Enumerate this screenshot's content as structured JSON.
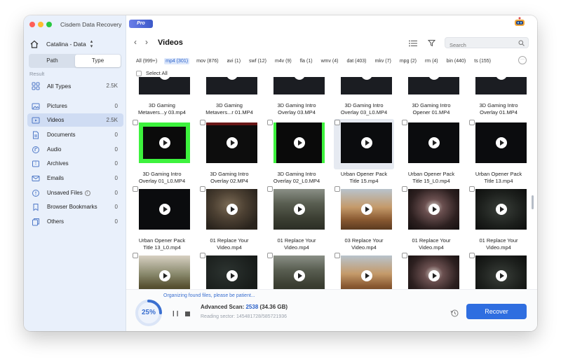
{
  "app": {
    "title": "Cisdem Data Recovery",
    "badge": "Pro"
  },
  "sidebar": {
    "drive": "Catalina - Data",
    "tabs": [
      "Path",
      "Type"
    ],
    "active_tab": "Type",
    "result_label": "Result",
    "items": [
      {
        "label": "All Types",
        "count": "2.5K",
        "icon": "grid-icon"
      },
      {
        "label": "Pictures",
        "count": "0",
        "icon": "picture-icon"
      },
      {
        "label": "Videos",
        "count": "2.5K",
        "icon": "video-icon",
        "selected": true
      },
      {
        "label": "Documents",
        "count": "0",
        "icon": "document-icon"
      },
      {
        "label": "Audio",
        "count": "0",
        "icon": "audio-icon"
      },
      {
        "label": "Archives",
        "count": "0",
        "icon": "archive-icon"
      },
      {
        "label": "Emails",
        "count": "0",
        "icon": "email-icon"
      },
      {
        "label": "Unsaved Files",
        "count": "0",
        "icon": "unsaved-icon"
      },
      {
        "label": "Browser Bookmarks",
        "count": "0",
        "icon": "bookmark-icon"
      },
      {
        "label": "Others",
        "count": "0",
        "icon": "others-icon"
      }
    ]
  },
  "header": {
    "title": "Videos",
    "search_placeholder": "Search"
  },
  "filters": {
    "types": [
      "All (999+)",
      "mp4 (301)",
      "mov (876)",
      "avi (1)",
      "swf (12)",
      "m4v (9)",
      "fla (1)",
      "wmv (4)",
      "dat (403)",
      "mkv (7)",
      "mpg (2)",
      "rm (4)",
      "bin (440)",
      "ts (155)"
    ],
    "active": "mp4 (301)",
    "select_all": "Select All"
  },
  "files": [
    {
      "name1": "3D Gaming",
      "name2": "Metavers...y 03.mp4",
      "thumb": "partial"
    },
    {
      "name1": "3D Gaming",
      "name2": "Metavers...r 01.MP4",
      "thumb": "partial"
    },
    {
      "name1": "3D Gaming Intro",
      "name2": "Overlay 03.MP4",
      "thumb": "partial"
    },
    {
      "name1": "3D Gaming Intro",
      "name2": "Overlay 03_L0.MP4",
      "thumb": "partial"
    },
    {
      "name1": "3D Gaming Intro",
      "name2": "Opener 01.MP4",
      "thumb": "partial"
    },
    {
      "name1": "3D Gaming Intro",
      "name2": "Overlay 01.MP4",
      "thumb": "partial"
    },
    {
      "name1": "3D Gaming Intro",
      "name2": "Overlay 01_L0.MP4",
      "thumb": "green"
    },
    {
      "name1": "3D Gaming Intro",
      "name2": "Overlay 02.MP4",
      "thumb": "redline"
    },
    {
      "name1": "3D Gaming Intro",
      "name2": "Overlay 02_L0.MP4",
      "thumb": "green2"
    },
    {
      "name1": "Urban Opener Pack",
      "name2": "Title 15.mp4",
      "thumb": "dark",
      "selected": true
    },
    {
      "name1": "Urban Opener Pack",
      "name2": "Title 15_L0.mp4",
      "thumb": "dark"
    },
    {
      "name1": "Urban Opener Pack",
      "name2": "Title 13.mp4",
      "thumb": "dark"
    },
    {
      "name1": "Urban Opener Pack",
      "name2": "Title 13_L0.mp4",
      "thumb": "dark"
    },
    {
      "name1": "01 Replace Your",
      "name2": "Video.mp4",
      "thumb": "cave"
    },
    {
      "name1": "01 Replace Your",
      "name2": "Video.mp4",
      "thumb": "canyon"
    },
    {
      "name1": "03 Replace Your",
      "name2": "Video.mp4",
      "thumb": "desert"
    },
    {
      "name1": "01 Replace Your",
      "name2": "Video.mp4",
      "thumb": "tunnel"
    },
    {
      "name1": "01 Replace Your",
      "name2": "Video.mp4",
      "thumb": "darkcave"
    },
    {
      "name1": "",
      "name2": "",
      "thumb": "hiker"
    },
    {
      "name1": "",
      "name2": "",
      "thumb": "darkgreen"
    },
    {
      "name1": "",
      "name2": "",
      "thumb": "canyon"
    },
    {
      "name1": "",
      "name2": "",
      "thumb": "desert"
    },
    {
      "name1": "",
      "name2": "",
      "thumb": "tunnel"
    },
    {
      "name1": "",
      "name2": "",
      "thumb": "darkcave"
    }
  ],
  "status": {
    "organizing": "Organizing found files, please be patient...",
    "progress": "25%",
    "progress_value": 0.25,
    "scan_label": "Advanced Scan:",
    "scan_count": "2538",
    "scan_size": "(34.36 GB)",
    "sector": "Reading sector: 145481728/585721936",
    "recover": "Recover"
  }
}
